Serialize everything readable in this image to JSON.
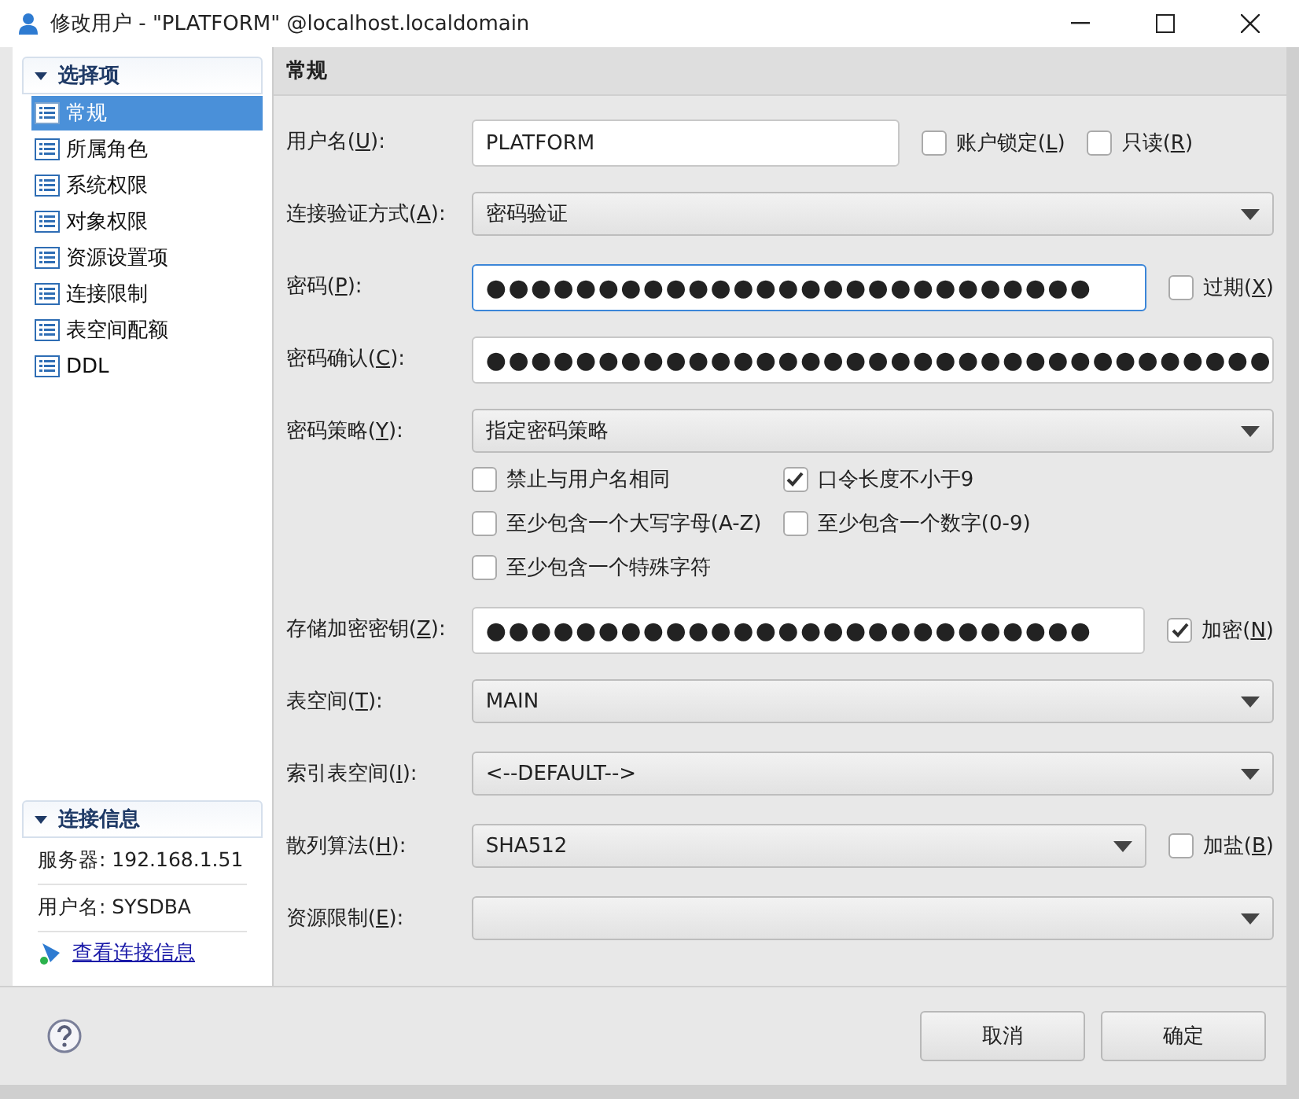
{
  "window": {
    "title": "修改用户 - \"PLATFORM\" @localhost.localdomain"
  },
  "sidebar": {
    "title": "选择项",
    "expanded": true,
    "items": [
      {
        "label": "常规",
        "selected": true
      },
      {
        "label": "所属角色",
        "selected": false
      },
      {
        "label": "系统权限",
        "selected": false
      },
      {
        "label": "对象权限",
        "selected": false
      },
      {
        "label": "资源设置项",
        "selected": false
      },
      {
        "label": "连接限制",
        "selected": false
      },
      {
        "label": "表空间配额",
        "selected": false
      },
      {
        "label": "DDL",
        "selected": false
      }
    ]
  },
  "connection_info": {
    "title": "连接信息",
    "expanded": true,
    "lines": [
      "服务器: 192.168.1.51",
      "用户名: SYSDBA"
    ],
    "link": "查看连接信息"
  },
  "panel": {
    "title": "常规",
    "rows": [
      {
        "kind": "text",
        "label": {
          "before": "用户名(",
          "key": "U",
          "after": "):"
        },
        "value": "PLATFORM",
        "options": [
          {
            "label": {
              "before": "账户锁定(",
              "key": "L",
              "after": ")"
            },
            "checked": false
          },
          {
            "label": {
              "before": "只读(",
              "key": "R",
              "after": ")"
            },
            "checked": false
          }
        ]
      },
      {
        "kind": "select",
        "label": {
          "before": "连接验证方式(",
          "key": "A",
          "after": "):"
        },
        "value": "密码验证"
      },
      {
        "kind": "password",
        "focused": true,
        "label": {
          "before": "密码(",
          "key": "P",
          "after": "):"
        },
        "value": "●●●●●●●●●●●●●●●●●●●●●●●●●●●",
        "options": [
          {
            "label": {
              "before": "过期(",
              "key": "X",
              "after": ")"
            },
            "checked": false
          }
        ]
      },
      {
        "kind": "password",
        "focused": false,
        "label": {
          "before": "密码确认(",
          "key": "C",
          "after": "):"
        },
        "value": "●●●●●●●●●●●●●●●●●●●●●●●●●●●●●●●●●●●"
      },
      {
        "kind": "select",
        "label": {
          "before": "密码策略(",
          "key": "Y",
          "after": "):"
        },
        "value": "指定密码策略",
        "checks": [
          {
            "label": "禁止与用户名相同",
            "checked": false
          },
          {
            "label": "口令长度不小于9",
            "checked": true
          },
          {
            "label": "至少包含一个大写字母(A-Z)",
            "checked": false
          },
          {
            "label": "至少包含一个数字(0-9)",
            "checked": false
          },
          {
            "label": "至少包含一个特殊字符",
            "checked": false
          }
        ]
      },
      {
        "kind": "password",
        "focused": false,
        "label": {
          "before": "存储加密密钥(",
          "key": "Z",
          "after": "):"
        },
        "value": "●●●●●●●●●●●●●●●●●●●●●●●●●●●",
        "options": [
          {
            "label": {
              "before": "加密(",
              "key": "N",
              "after": ")"
            },
            "checked": true
          }
        ]
      },
      {
        "kind": "select",
        "label": {
          "before": "表空间(",
          "key": "T",
          "after": "):"
        },
        "value": "MAIN"
      },
      {
        "kind": "select",
        "label": {
          "before": "索引表空间(",
          "key": "I",
          "after": "):"
        },
        "value": "<--DEFAULT-->"
      },
      {
        "kind": "select",
        "label": {
          "before": "散列算法(",
          "key": "H",
          "after": "):"
        },
        "value": "SHA512",
        "options": [
          {
            "label": {
              "before": "加盐(",
              "key": "B",
              "after": ")"
            },
            "checked": false
          }
        ]
      },
      {
        "kind": "select",
        "label": {
          "before": "资源限制(",
          "key": "E",
          "after": "):"
        }
      }
    ]
  },
  "buttons": [
    {
      "label": "取消"
    },
    {
      "label": "确定"
    }
  ]
}
